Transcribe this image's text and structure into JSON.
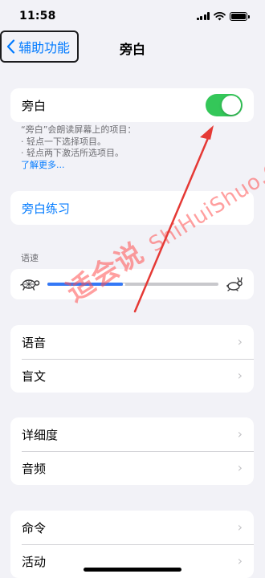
{
  "status_bar": {
    "time": "11:58"
  },
  "nav": {
    "back_label": "辅助功能",
    "title": "旁白"
  },
  "voiceover": {
    "label": "旁白",
    "enabled": true,
    "footer_line1": "“旁白”会朗读屏幕上的项目：",
    "footer_line2": "·  轻点一下选择项目。",
    "footer_line3": "·  轻点两下激活所选项目。",
    "footer_link": "了解更多..."
  },
  "practice": {
    "label": "旁白练习"
  },
  "speaking_rate": {
    "header": "语速",
    "value_fraction": 0.44
  },
  "group_speech": [
    "语音",
    "盲文"
  ],
  "group_verbosity": [
    "详细度",
    "音频"
  ],
  "group_commands": [
    "命令",
    "活动"
  ],
  "watermark": {
    "line": "适会说",
    "domain": "ShiHuiShuo.Com"
  },
  "colors": {
    "accent": "#007aff",
    "toggle_on": "#34c759",
    "annotation": "#e53935"
  }
}
